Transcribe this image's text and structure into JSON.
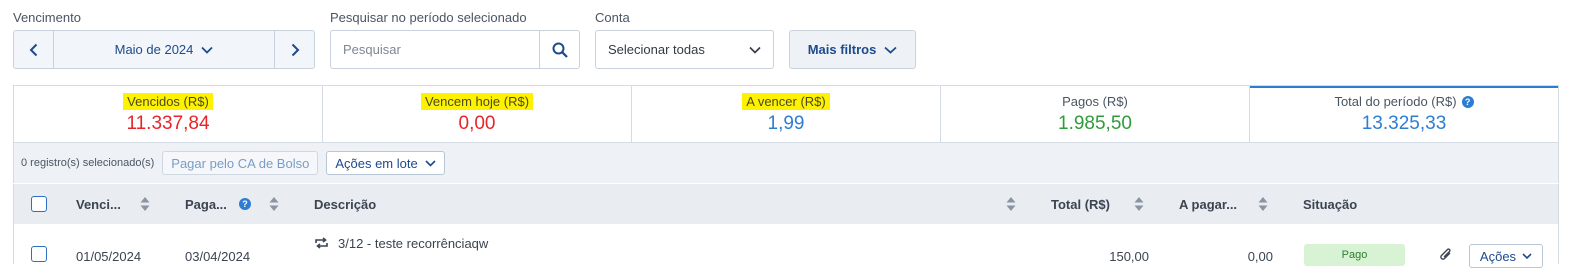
{
  "filters": {
    "vencimento_label": "Vencimento",
    "month": "Maio de 2024",
    "search_label": "Pesquisar no período selecionado",
    "search_placeholder": "Pesquisar",
    "conta_label": "Conta",
    "conta_value": "Selecionar todas",
    "more_filters": "Mais filtros"
  },
  "summary": [
    {
      "title": "Vencidos (R$)",
      "value": "11.337,84",
      "color": "#e8242b",
      "highlighted": true
    },
    {
      "title": "Vencem hoje (R$)",
      "value": "0,00",
      "color": "#e8242b",
      "highlighted": true
    },
    {
      "title": "A vencer (R$)",
      "value": "1,99",
      "color": "#2d7dd2",
      "highlighted": true
    },
    {
      "title": "Pagos (R$)",
      "value": "1.985,50",
      "color": "#2e9c3a",
      "highlighted": false
    },
    {
      "title": "Total do período (R$)",
      "value": "13.325,33",
      "color": "#2d7dd2",
      "highlighted": false
    }
  ],
  "action_bar": {
    "selected_count": "0 registro(s) selecionado(s)",
    "pay_button": "Pagar pelo CA de Bolso",
    "bulk_actions": "Ações em lote"
  },
  "table": {
    "columns": [
      "Venci...",
      "Paga...",
      "Descrição",
      "Total (R$)",
      "A pagar...",
      "Situação"
    ],
    "rows": [
      {
        "vencimento": "01/05/2024",
        "pagamento": "03/04/2024",
        "descricao": "3/12 - teste recorrênciaqw",
        "total": "150,00",
        "a_pagar": "0,00",
        "situacao": "Pago",
        "acoes": "Ações"
      }
    ]
  }
}
